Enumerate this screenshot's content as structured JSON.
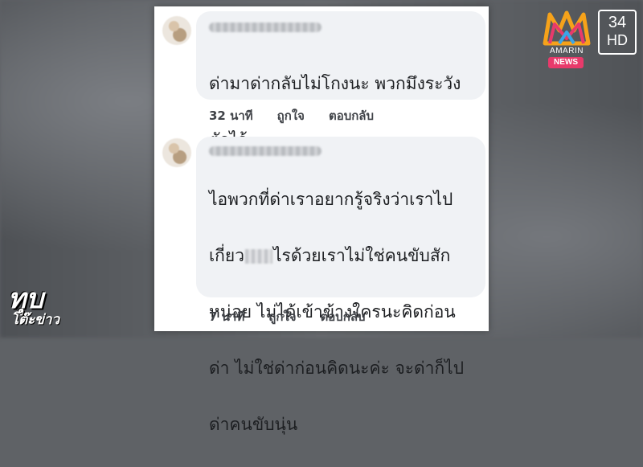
{
  "comments": [
    {
      "text_lines": [
        "ด่ามาด่ากลับไม่โกงนะ พวกมึงระวัง",
        "ตัวไว้"
      ],
      "time": "32 นาที",
      "like_label": "ถูกใจ",
      "reply_label": "ตอบกลับ"
    },
    {
      "line1": "ไอพวกที่ด่าเราอยากรู้จริงว่าเราไป",
      "line2_pre": "เกี่ยว",
      "line2_post": "ไรด้วยเราไม่ใช่คนขับสัก",
      "line3": "หน่อย ไม่ได้เข้าข้างใครนะคิดก่อน",
      "line4": "ด่า ไม่ใช่ด่าก่อนคิดนะค่ะ จะด่าก็ไป",
      "line5": "ด่าคนขับนุ่น",
      "time": "7 นาที",
      "like_label": "ถูกใจ",
      "reply_label": "ตอบกลับ"
    }
  ],
  "broadcaster": {
    "name": "AMARIN",
    "tag": "NEWS",
    "channel_number": "34",
    "channel_hd": "HD"
  },
  "program_logo": {
    "line1": "ทุบ",
    "line2": "โต๊ะข่าว"
  },
  "colors": {
    "bubble": "#f0f2f5",
    "text": "#1c1e21",
    "news_pill": "#e83a6b"
  }
}
